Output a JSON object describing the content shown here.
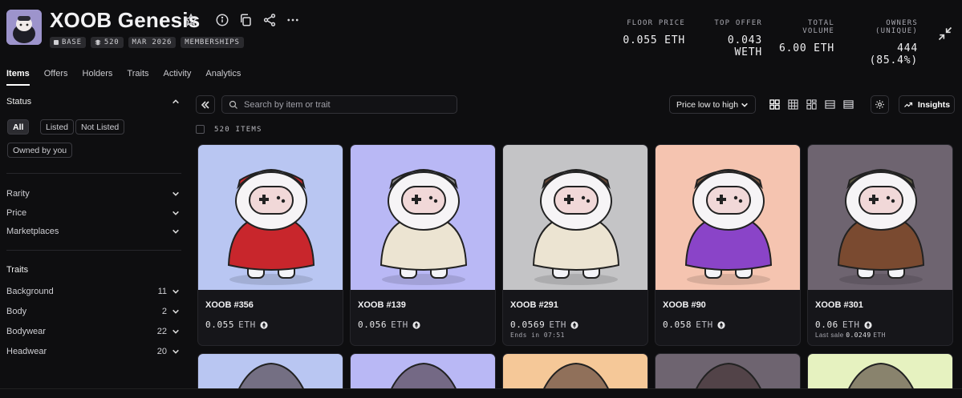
{
  "collection": {
    "name": "XOOB Genesis",
    "badges": [
      {
        "icon": "base-chain-icon",
        "label": "BASE"
      },
      {
        "icon": "stack-icon",
        "label": "520"
      },
      {
        "icon": "",
        "label": "MAR 2026"
      },
      {
        "icon": "",
        "label": "MEMBERSHIPS"
      }
    ]
  },
  "stats": [
    {
      "label": "FLOOR PRICE",
      "value": "0.055 ETH"
    },
    {
      "label": "TOP OFFER",
      "value": "0.043 WETH"
    },
    {
      "label": "TOTAL VOLUME",
      "value": "6.00 ETH"
    },
    {
      "label": "OWNERS (UNIQUE)",
      "value": "444 (85.4%)"
    }
  ],
  "tabs": [
    "Items",
    "Offers",
    "Holders",
    "Traits",
    "Activity",
    "Analytics"
  ],
  "active_tab": "Items",
  "sidebar": {
    "status_label": "Status",
    "status_options": [
      "All",
      "Listed",
      "Not Listed",
      "Owned by you"
    ],
    "selected_status": "All",
    "filters": [
      "Rarity",
      "Price",
      "Marketplaces"
    ],
    "traits_label": "Traits",
    "traits": [
      {
        "label": "Background",
        "count": "11"
      },
      {
        "label": "Body",
        "count": "2"
      },
      {
        "label": "Bodywear",
        "count": "22"
      },
      {
        "label": "Headwear",
        "count": "20"
      }
    ]
  },
  "toolbar": {
    "search_placeholder": "Search by item or trait",
    "sort_label": "Price low to high",
    "insights_label": "Insights"
  },
  "items_count": "520 ITEMS",
  "items": [
    {
      "name": "XOOB #356",
      "price": "0.055",
      "currency": "ETH",
      "sub": "",
      "bg": "#b9c6f2",
      "outfit": "#c8262c",
      "hat": "#c8262c"
    },
    {
      "name": "XOOB #139",
      "price": "0.056",
      "currency": "ETH",
      "sub": "",
      "bg": "#b9b8f5",
      "outfit": "#ece4d2",
      "hat": "#8c8c8c"
    },
    {
      "name": "XOOB #291",
      "price": "0.0569",
      "currency": "ETH",
      "sub": "Ends in 07:51",
      "bg": "#c4c4c6",
      "outfit": "#ece4d2",
      "hat": "#6a4a38"
    },
    {
      "name": "XOOB #90",
      "price": "0.058",
      "currency": "ETH",
      "sub": "",
      "bg": "#f5c4b0",
      "outfit": "#8a44c8",
      "hat": "#7a5a44"
    },
    {
      "name": "XOOB #301",
      "price": "0.06",
      "currency": "ETH",
      "sub_prefix": "Last sale",
      "sub_value": "0.0249",
      "sub_currency": "ETH",
      "bg": "#6e6470",
      "outfit": "#7a4a30",
      "hat": "#5d5a44"
    }
  ],
  "next_row_bgs": [
    "#b9c6f2",
    "#b9b8f5",
    "#f5c898",
    "#6e6470",
    "#e6f2c0"
  ]
}
